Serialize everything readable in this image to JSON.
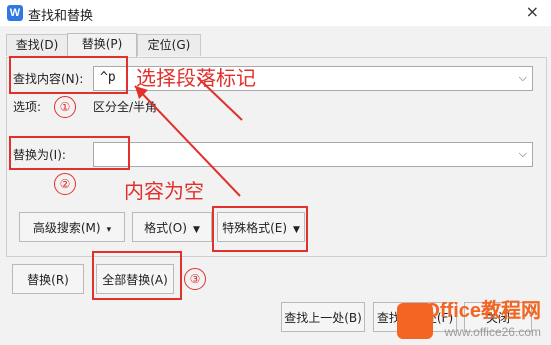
{
  "window": {
    "title": "查找和替换",
    "close_label": "×"
  },
  "tabs": [
    {
      "label": "查找(D)"
    },
    {
      "label": "替换(P)"
    },
    {
      "label": "定位(G)"
    }
  ],
  "find": {
    "label": "查找内容(N):",
    "value": "^p",
    "options_label": "选项:",
    "options_value": "区分全/半角"
  },
  "replace": {
    "label": "替换为(I):",
    "value": ""
  },
  "buttons": {
    "advanced": "高级搜索(M)",
    "format": "格式(O)",
    "special": "特殊格式(E)",
    "replace": "替换(R)",
    "replace_all": "全部替换(A)",
    "find_prev": "查找上一处(B)",
    "find_next": "查找下一处(F)",
    "close": "关闭"
  },
  "annotations": {
    "note1": "选择段落标记",
    "note2": "内容为空",
    "n1": "①",
    "n2": "②",
    "n3": "③",
    "accent": "#e0312c"
  },
  "watermark": {
    "brand": "Office教程网",
    "url": "www.office26.com"
  }
}
